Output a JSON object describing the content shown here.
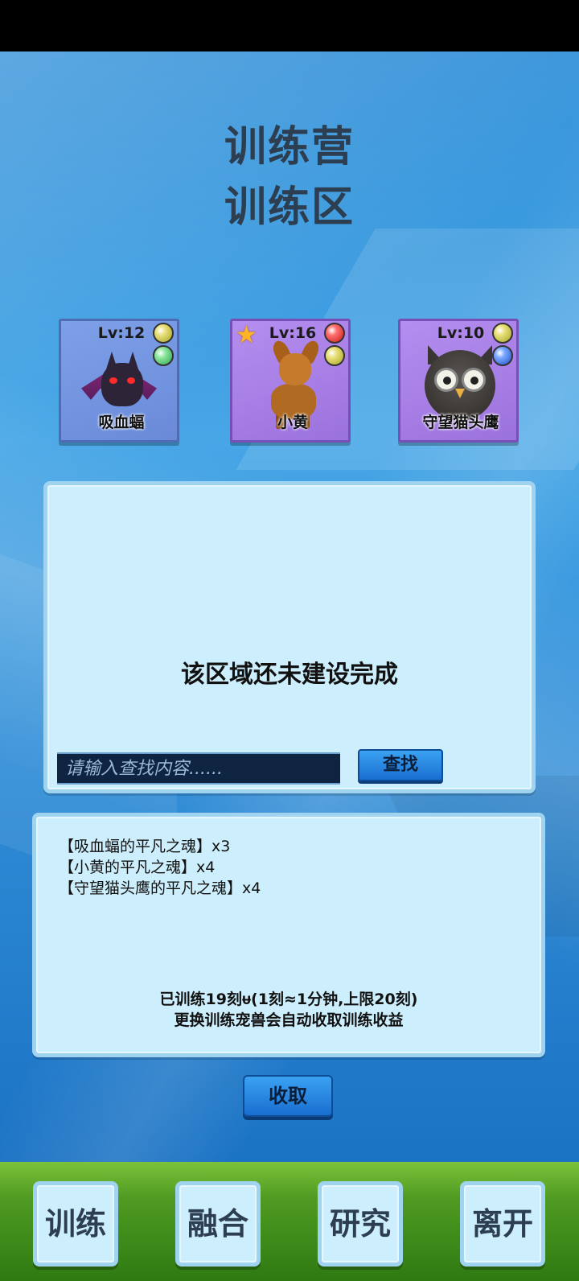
{
  "header": {
    "title": "训练营",
    "subtitle": "训练区"
  },
  "pets": [
    {
      "level": "Lv:12",
      "name": "吸血蝠",
      "gems": [
        "yellow",
        "green"
      ],
      "starred": false,
      "card_color": "#7ea0e8"
    },
    {
      "level": "Lv:16",
      "name": "小黄",
      "gems": [
        "red",
        "yellow"
      ],
      "starred": true,
      "card_color": "#b58ef0"
    },
    {
      "level": "Lv:10",
      "name": "守望猫头鹰",
      "gems": [
        "yellow",
        "blue"
      ],
      "starred": false,
      "card_color": "#b58ef0"
    }
  ],
  "area": {
    "status_text": "该区域还未建设完成",
    "search_placeholder": "请输入查找内容......",
    "search_button": "查找"
  },
  "rewards": {
    "items": [
      "【吸血蝠的平凡之魂】x3",
      "【小黄的平凡之魂】x4",
      "【守望猫头鹰的平凡之魂】x4"
    ],
    "trained_info": "已训练19刻ᵾ(1刻≈1分钟,上限20刻)",
    "note": "更换训练宠兽会自动收取训练收益"
  },
  "collect_button": "收取",
  "nav": {
    "train": "训练",
    "fuse": "融合",
    "research": "研究",
    "leave": "离开"
  }
}
